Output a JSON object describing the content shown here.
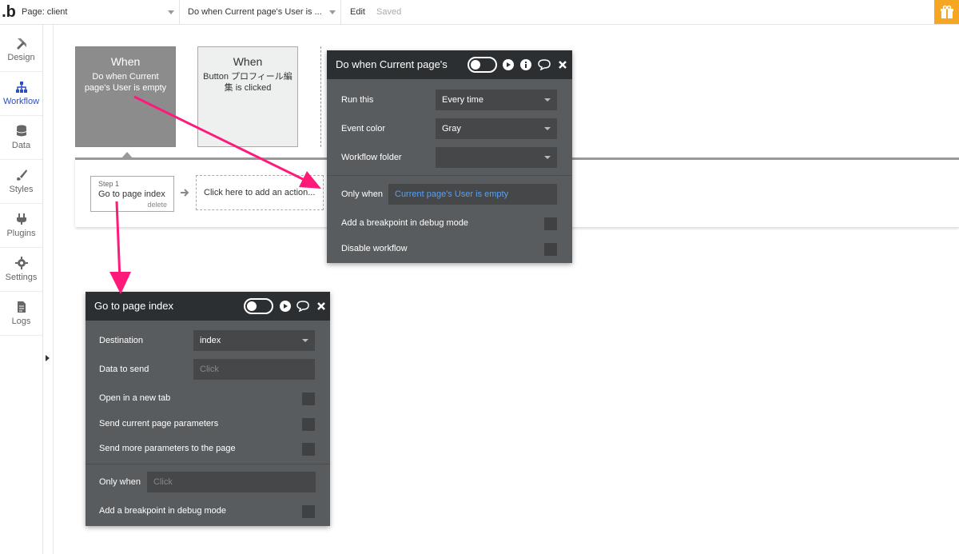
{
  "topbar": {
    "logo": ".b",
    "page_select": "Page: client",
    "workflow_select": "Do when Current page's User is ...",
    "edit": "Edit",
    "saved": "Saved"
  },
  "sidebar": {
    "items": [
      {
        "label": "Design",
        "icon": "design-icon"
      },
      {
        "label": "Workflow",
        "icon": "workflow-icon",
        "active": true
      },
      {
        "label": "Data",
        "icon": "database-icon"
      },
      {
        "label": "Styles",
        "icon": "brush-icon"
      },
      {
        "label": "Plugins",
        "icon": "plug-icon"
      },
      {
        "label": "Settings",
        "icon": "gear-icon"
      },
      {
        "label": "Logs",
        "icon": "document-icon"
      }
    ]
  },
  "events": [
    {
      "when": "When",
      "desc": "Do when Current page's User is empty"
    },
    {
      "when": "When",
      "desc": "Button プロフィール編集 is clicked"
    }
  ],
  "step": {
    "number": "Step 1",
    "title": "Go to page index",
    "delete": "delete",
    "add_action": "Click here to add an action..."
  },
  "event_panel": {
    "title": "Do when Current page's",
    "run_this_label": "Run this",
    "run_this_value": "Every time",
    "event_color_label": "Event color",
    "event_color_value": "Gray",
    "folder_label": "Workflow folder",
    "folder_value": "",
    "only_when_label": "Only when",
    "only_when_value": "Current page's User is empty",
    "breakpoint_label": "Add a breakpoint in debug mode",
    "disable_label": "Disable workflow"
  },
  "action_panel": {
    "title": "Go to page index",
    "destination_label": "Destination",
    "destination_value": "index",
    "data_label": "Data to send",
    "data_placeholder": "Click",
    "new_tab_label": "Open in a new tab",
    "send_params_label": "Send current page parameters",
    "more_params_label": "Send more parameters to the page",
    "only_when_label": "Only when",
    "only_when_placeholder": "Click",
    "breakpoint_label": "Add a breakpoint in debug mode"
  },
  "colors": {
    "accent": "#2b4fc4",
    "arrow": "#ff1a7a",
    "panel_bg": "#595c5f",
    "panel_header": "#2c2f31",
    "gift": "#f5a623"
  }
}
